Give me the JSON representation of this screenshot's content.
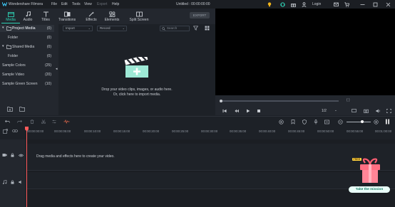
{
  "titlebar": {
    "app_name": "Wondershare Filmora",
    "menus": [
      "File",
      "Edit",
      "Tools",
      "View",
      "Export",
      "Help"
    ],
    "doc_title": "Untitled : 00:00:00:00",
    "login": "Login"
  },
  "toolbar": {
    "tabs": [
      "Media",
      "Audio",
      "Titles",
      "Transitions",
      "Effects",
      "Elements",
      "Split Screen"
    ],
    "export_label": "EXPORT"
  },
  "left_panel": {
    "items": [
      {
        "label": "Project Media",
        "count": "(0)"
      },
      {
        "label": "Folder",
        "count": "(0)"
      },
      {
        "label": "Shared Media",
        "count": "(0)"
      },
      {
        "label": "Folder",
        "count": "(0)"
      },
      {
        "label": "Sample Colors",
        "count": "(25)"
      },
      {
        "label": "Sample Video",
        "count": "(20)"
      },
      {
        "label": "Sample Green Screen",
        "count": "(10)"
      }
    ]
  },
  "media": {
    "import_label": "Import",
    "record_label": "Record",
    "search_placeholder": "Search",
    "drop_line1": "Drop your video clips, images, or audio here.",
    "drop_line2": "Or, click here to import media."
  },
  "preview": {
    "time_brackets": "{   }",
    "ratio": "1/2"
  },
  "timeline": {
    "timecodes": [
      "00:00:00:00",
      "00:00:05:00",
      "00:00:10:00",
      "00:00:15:00",
      "00:00:20:00",
      "00:00:25:00",
      "00:00:30:00",
      "00:00:35:00",
      "00:00:40:00",
      "00:00:45:00",
      "00:00:50:00",
      "00:00:55:00",
      "00:01:00:00"
    ],
    "drop_hint": "Drag media and effects here to create your video.",
    "badge": "FREE",
    "mission_label": "Take the mission"
  },
  "colors": {
    "accent": "#2fd4b6",
    "playhead": "#ff5a5a"
  }
}
